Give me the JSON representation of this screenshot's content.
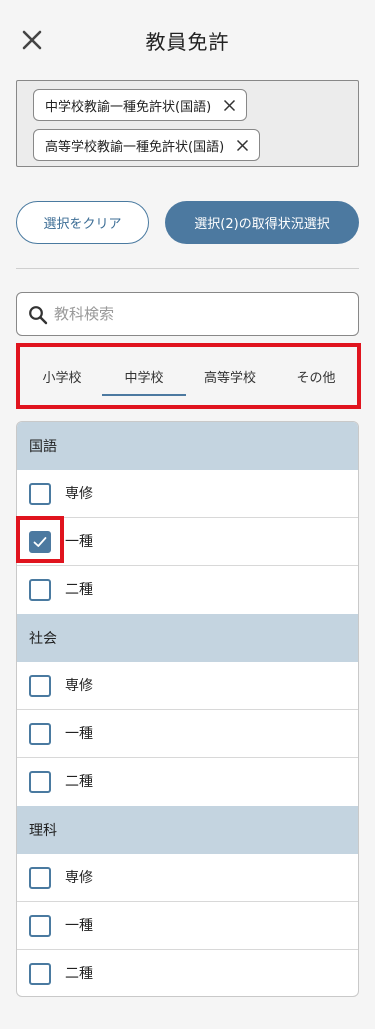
{
  "header": {
    "title": "教員免許",
    "close_icon": "close-icon"
  },
  "chips": [
    {
      "label": "中学校教諭一種免許状(国語)",
      "remove_icon": "close-icon"
    },
    {
      "label": "高等学校教諭一種免許状(国語)",
      "remove_icon": "close-icon"
    }
  ],
  "actions": {
    "clear_label": "選択をクリア",
    "select_label": "選択(2)の取得状況選択"
  },
  "search": {
    "placeholder": "教科検索",
    "value": "",
    "icon": "search-icon"
  },
  "tabs": [
    {
      "label": "小学校",
      "active": false
    },
    {
      "label": "中学校",
      "active": true
    },
    {
      "label": "高等学校",
      "active": false
    },
    {
      "label": "その他",
      "active": false
    }
  ],
  "groups": [
    {
      "name": "国語",
      "items": [
        {
          "label": "専修",
          "checked": false
        },
        {
          "label": "一種",
          "checked": true
        },
        {
          "label": "二種",
          "checked": false
        }
      ]
    },
    {
      "name": "社会",
      "items": [
        {
          "label": "専修",
          "checked": false
        },
        {
          "label": "一種",
          "checked": false
        },
        {
          "label": "二種",
          "checked": false
        }
      ]
    },
    {
      "name": "理科",
      "items": [
        {
          "label": "専修",
          "checked": false
        },
        {
          "label": "一種",
          "checked": false
        },
        {
          "label": "二種",
          "checked": false
        }
      ]
    }
  ],
  "colors": {
    "accent": "#4c79a0",
    "group_header_bg": "#c4d4e0",
    "highlight": "#e0141e"
  }
}
